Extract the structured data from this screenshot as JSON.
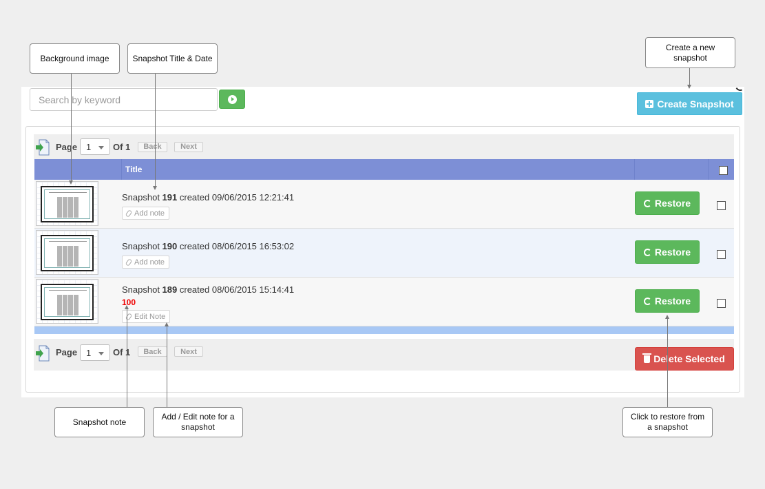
{
  "search": {
    "placeholder": "Search by keyword"
  },
  "toolbar": {
    "create_label": "Create Snapshot"
  },
  "pager": {
    "page_label": "Page",
    "current_page": "1",
    "of_label": "Of 1",
    "back_label": "Back",
    "next_label": "Next"
  },
  "table": {
    "columns": {
      "title": "Title"
    },
    "rows": [
      {
        "prefix": "Snapshot ",
        "number": "191",
        "suffix": " created 09/06/2015 12:21:41",
        "note": "",
        "note_button": "Add note",
        "restore_label": "Restore"
      },
      {
        "prefix": "Snapshot ",
        "number": "190",
        "suffix": " created 08/06/2015 16:53:02",
        "note": "",
        "note_button": "Add note",
        "restore_label": "Restore"
      },
      {
        "prefix": "Snapshot ",
        "number": "189",
        "suffix": " created 08/06/2015 15:14:41",
        "note": "100",
        "note_button": "Edit Note",
        "restore_label": "Restore"
      }
    ]
  },
  "actions": {
    "delete_label": "Delete Selected"
  },
  "callouts": {
    "background_image": "Background image",
    "snapshot_title_date": "Snapshot Title & Date",
    "create_new_snapshot": "Create a new snapshot",
    "snapshot_note": "Snapshot note",
    "add_edit_note": "Add / Edit note for a snapshot",
    "click_to_restore": "Click to restore from a snapshot"
  },
  "colors": {
    "header": "#7d8fd6",
    "restore": "#5cb85c",
    "create": "#5bc0de",
    "delete": "#d9534f",
    "note": "#ee0000"
  }
}
